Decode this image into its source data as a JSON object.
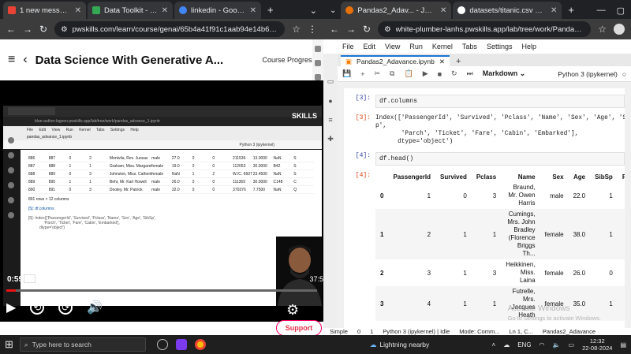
{
  "left_window": {
    "tabs": [
      {
        "title": "1 new message",
        "color": "#ea4335"
      },
      {
        "title": "Data Toolkit - Google",
        "color": "#34a853"
      },
      {
        "title": "linkedin - Google Sea",
        "color": "#4285f4"
      }
    ],
    "url": "pwskills.com/learn/course/genai/65b4a41f91c1aab94e14b68d/lesson/661...",
    "course_title": "Data Science With Generative A...",
    "course_progress": "Course Progress",
    "video": {
      "brand": "SKILLS",
      "time_elapsed": "0:59",
      "speed": "1x",
      "time_remaining": "37:5",
      "progress": 0.03,
      "inner_tab": "pandas_advance_1.ipynb",
      "inner_url": "blue-author-lagoon.pwskills.app/lab/tree/work/pandas_advance_1.ipynb",
      "inner_menu": [
        "File",
        "Edit",
        "View",
        "Run",
        "Kernel",
        "Tabs",
        "Settings",
        "Help"
      ],
      "inner_kernel": "Python 3 (ipykernel)",
      "inner_rows": [
        [
          "886",
          "887",
          "0",
          "2",
          "Montvila, Rev. Juozas",
          "male",
          "27.0",
          "0",
          "0",
          "211536",
          "13.0000",
          "NaN",
          "S"
        ],
        [
          "887",
          "888",
          "1",
          "1",
          "Graham, Miss. Margaret Edith",
          "female",
          "19.0",
          "0",
          "0",
          "112053",
          "30.0000",
          "B42",
          "S"
        ],
        [
          "888",
          "889",
          "0",
          "3",
          "Johnston, Miss. Catherine Helen \"Carrie\"",
          "female",
          "NaN",
          "1",
          "2",
          "W./C. 6607",
          "23.4500",
          "NaN",
          "S"
        ],
        [
          "889",
          "890",
          "1",
          "1",
          "Behr, Mr. Karl Howell",
          "male",
          "26.0",
          "0",
          "0",
          "111369",
          "30.0000",
          "C148",
          "C"
        ],
        [
          "890",
          "891",
          "0",
          "3",
          "Dooley, Mr. Patrick",
          "male",
          "32.0",
          "0",
          "0",
          "370376",
          "7.7500",
          "NaN",
          "Q"
        ]
      ],
      "inner_rowcount": "891 rows × 12 columns",
      "inner_code_in": "[5]: df.columns",
      "inner_code_out1": "[5]: Index(['PassengerId', 'Survived', 'Pclass', 'Name', 'Sex', 'Age', 'SibSp',",
      "inner_code_out2": "'Parch', 'Ticket', 'Fare', 'Cabin', 'Embarked'],",
      "inner_code_out3": "dtype='object')"
    },
    "support_label": "Support"
  },
  "right_window": {
    "tabs": [
      {
        "title": "Pandas2_Adav... - JupyterLab",
        "color": "#e8710a"
      },
      {
        "title": "datasets/titanic.csv at maste",
        "color": "#ffffff"
      }
    ],
    "url": "white-plumber-lanhs.pwskills.app/lab/tree/work/Pandas/Pan...",
    "menu": [
      "File",
      "Edit",
      "View",
      "Run",
      "Kernel",
      "Tabs",
      "Settings",
      "Help"
    ],
    "notebook_tab": "Pandas2_Adavance.ipynb",
    "cell_type": "Markdown",
    "kernel": "Python 3 (ipykernel)",
    "cells": {
      "in3": {
        "prompt": "[3]:",
        "code": "df.columns"
      },
      "out3": {
        "prompt": "[3]:",
        "lines": [
          "Index(['PassengerId', 'Survived', 'Pclass', 'Name', 'Sex', 'Age', 'SibS",
          "p',",
          "       'Parch', 'Ticket', 'Fare', 'Cabin', 'Embarked'],",
          "      dtype='object')"
        ]
      },
      "in4": {
        "prompt": "[4]:",
        "code": "df.head()"
      },
      "out4": {
        "prompt": "[4]:"
      }
    },
    "table": {
      "columns": [
        "",
        "PassengerId",
        "Survived",
        "Pclass",
        "Name",
        "Sex",
        "Age",
        "SibSp",
        "Parch",
        "T"
      ],
      "rows": [
        [
          "0",
          "1",
          "0",
          "3",
          "Braund, Mr. Owen Harris",
          "male",
          "22.0",
          "1",
          "0",
          "2"
        ],
        [
          "1",
          "2",
          "1",
          "1",
          "Cumings, Mrs. John Bradley (Florence Briggs Th...",
          "female",
          "38.0",
          "1",
          "0",
          "PC 1"
        ],
        [
          "2",
          "3",
          "1",
          "3",
          "Heikkinen, Miss. Laina",
          "female",
          "26.0",
          "0",
          "0",
          "STON 310"
        ],
        [
          "3",
          "4",
          "1",
          "1",
          "Futrelle, Mrs. Jacques Heath",
          "female",
          "35.0",
          "1",
          "0",
          "11"
        ]
      ]
    },
    "watermark_title": "Activate Windows",
    "watermark_sub": "Go to Settings to activate Windows.",
    "status": {
      "mode": "Simple",
      "count0": "0",
      "count1": "1",
      "kernel": "Python 3 (ipykernel) | Idle",
      "edit_mode": "Mode: Comm...",
      "cursor": "Ln 1, C...",
      "file": "Pandas2_Adavance"
    }
  },
  "taskbar": {
    "search_placeholder": "Type here to search",
    "weather": "Lightning nearby",
    "lang": "ENG",
    "time": "12:32",
    "date": "22-08-2024"
  }
}
